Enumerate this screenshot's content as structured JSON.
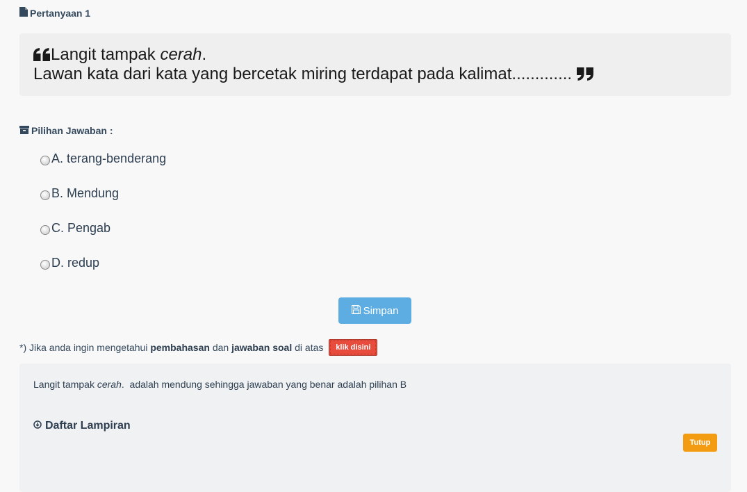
{
  "header": {
    "title": "Pertanyaan 1",
    "icon": "file-icon"
  },
  "question": {
    "line1_prefix": "Langit tampak ",
    "line1_italic": "cerah",
    "line1_suffix": ".",
    "line2": "Lawan kata dari kata yang bercetak miring terdapat pada kalimat.............",
    "icons": [
      "quote-left-icon",
      "quote-right-icon"
    ]
  },
  "choices": {
    "label": "Pilihan Jawaban :",
    "icon": "archive-icon",
    "options": [
      {
        "text": "A. terang-benderang"
      },
      {
        "text": "B. Mendung"
      },
      {
        "text": "C. Pengab"
      },
      {
        "text": "D. redup"
      }
    ]
  },
  "save_button": {
    "label": "Simpan",
    "icon": "floppy-disk-icon",
    "color": "#5dade2"
  },
  "hint": {
    "part1": "*) Jika anda ingin mengetahui ",
    "bold1": "pembahasan",
    "part2": " dan ",
    "bold2": "jawaban soal",
    "part3": " di atas ",
    "button_label": "klik disini",
    "button_color": "#e74c3c"
  },
  "explanation": {
    "prefix": "Langit tampak ",
    "italic": "cerah",
    "suffix": ".  adalah mendung sehingga jawaban yang benar adalah pilihan B",
    "attachments_title": "Daftar Lampiran",
    "attachments_icon": "circle-arrow-down-icon",
    "close_label": "Tutup",
    "close_color": "#f39c12"
  }
}
